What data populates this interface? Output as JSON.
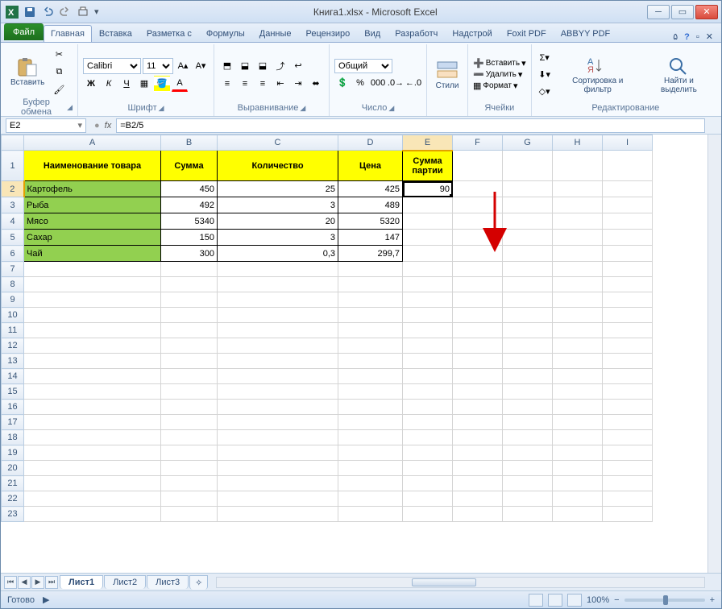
{
  "title": "Книга1.xlsx - Microsoft Excel",
  "tabs": {
    "file": "Файл",
    "home": "Главная",
    "insert": "Вставка",
    "layout": "Разметка с",
    "formulas": "Формулы",
    "data": "Данные",
    "review": "Рецензиро",
    "view": "Вид",
    "dev": "Разработч",
    "addins": "Надстрой",
    "foxit": "Foxit PDF",
    "abbyy": "ABBYY PDF"
  },
  "ribbon": {
    "clipboard": {
      "paste": "Вставить",
      "label": "Буфер обмена"
    },
    "font": {
      "name": "Calibri",
      "size": "11",
      "label": "Шрифт"
    },
    "align": {
      "label": "Выравнивание"
    },
    "number": {
      "fmt": "Общий",
      "label": "Число"
    },
    "styles": {
      "btn": "Стили",
      "label": ""
    },
    "cells": {
      "insert": "Вставить",
      "delete": "Удалить",
      "format": "Формат",
      "label": "Ячейки"
    },
    "editing": {
      "sort": "Сортировка и фильтр",
      "find": "Найти и выделить",
      "label": "Редактирование"
    }
  },
  "namebox": "E2",
  "formula": "=B2/5",
  "cols": [
    "A",
    "B",
    "C",
    "D",
    "E",
    "F",
    "G",
    "H",
    "I"
  ],
  "headers": {
    "A": "Наименование товара",
    "B": "Сумма",
    "C": "Количество",
    "D": "Цена",
    "E": "Сумма партии"
  },
  "rows": [
    {
      "n": "2",
      "A": "Картофель",
      "B": "450",
      "C": "25",
      "D": "425",
      "E": "90"
    },
    {
      "n": "3",
      "A": "Рыба",
      "B": "492",
      "C": "3",
      "D": "489",
      "E": ""
    },
    {
      "n": "4",
      "A": "Мясо",
      "B": "5340",
      "C": "20",
      "D": "5320",
      "E": ""
    },
    {
      "n": "5",
      "A": "Сахар",
      "B": "150",
      "C": "3",
      "D": "147",
      "E": ""
    },
    {
      "n": "6",
      "A": "Чай",
      "B": "300",
      "C": "0,3",
      "D": "299,7",
      "E": ""
    }
  ],
  "emptyRows": [
    "7",
    "8",
    "9",
    "10",
    "11",
    "12",
    "13",
    "14",
    "15",
    "16",
    "17",
    "18",
    "19",
    "20",
    "21",
    "22",
    "23"
  ],
  "sheets": {
    "s1": "Лист1",
    "s2": "Лист2",
    "s3": "Лист3"
  },
  "status": {
    "ready": "Готово",
    "zoom": "100%"
  }
}
